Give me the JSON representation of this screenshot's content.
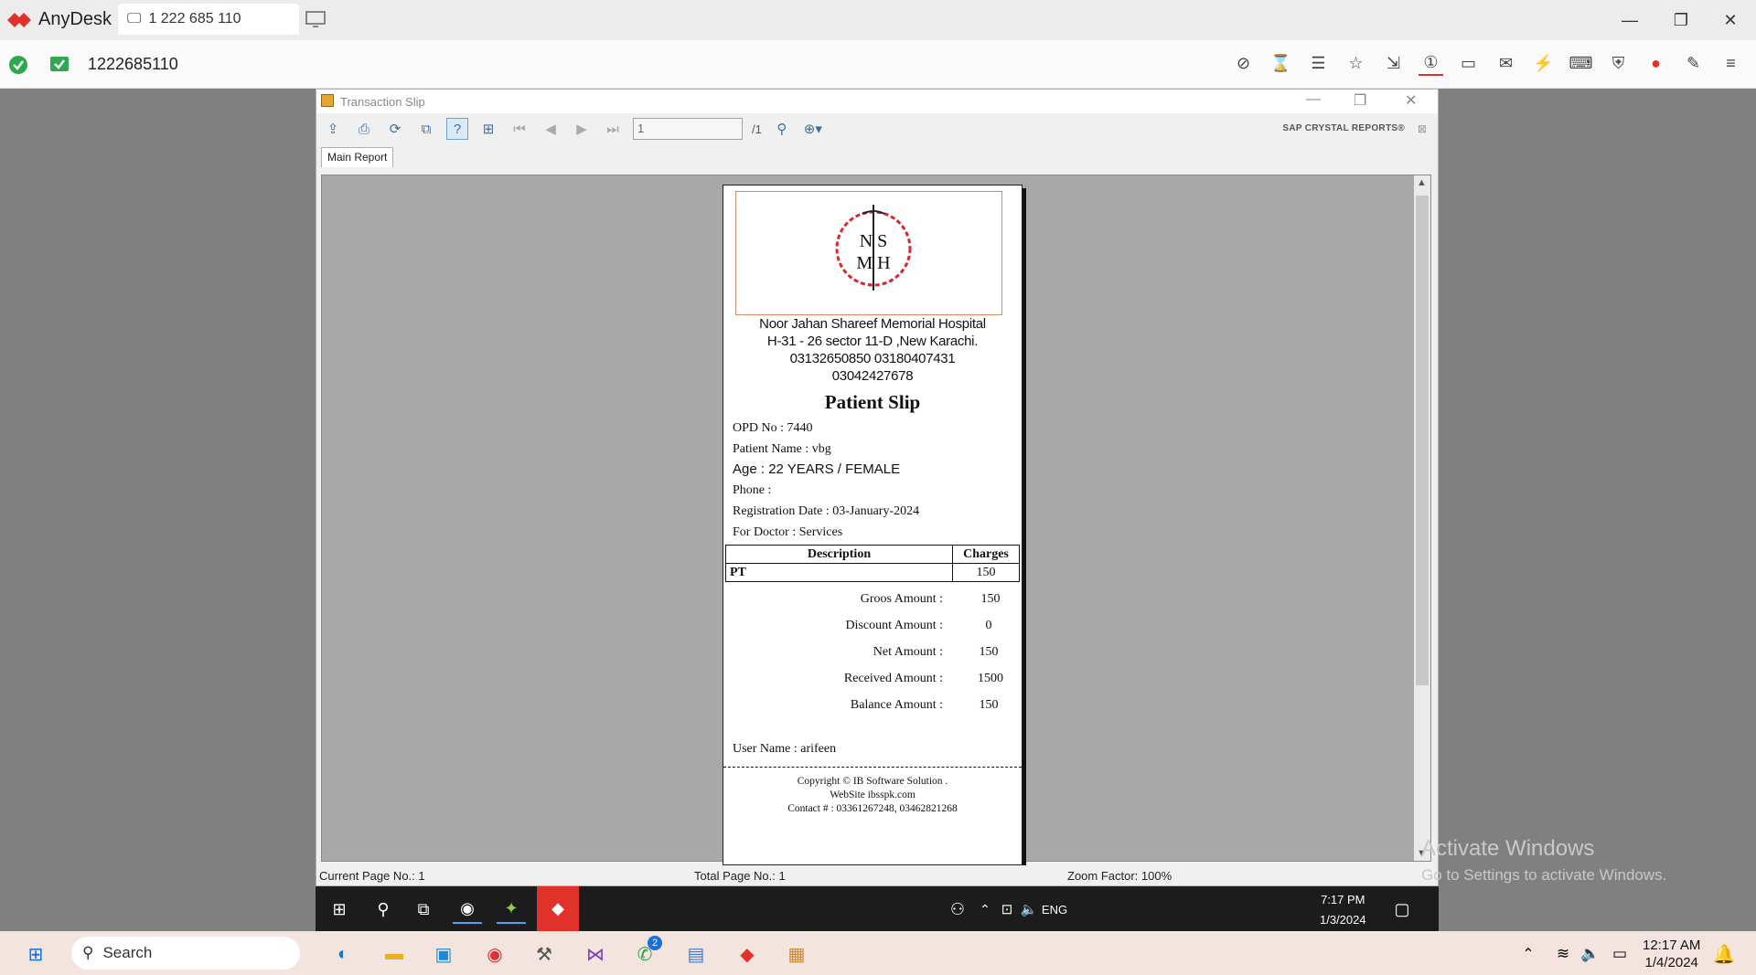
{
  "anydesk": {
    "app_name": "AnyDesk",
    "tab_label": "1 222 685 110",
    "remote_id": "1222685110"
  },
  "crystal": {
    "window_title": "Transaction Slip",
    "page_input": "1",
    "page_total": "/1",
    "brand": "SAP CRYSTAL REPORTS®",
    "tab": "Main Report",
    "status_current": "Current Page No.: 1",
    "status_total": "Total Page No.: 1",
    "status_zoom": "Zoom Factor: 100%"
  },
  "report": {
    "logo_text_top": "N S",
    "logo_text_bottom": "M H",
    "hospital_name": "Noor Jahan Shareef Memorial Hospital",
    "address": "H-31 - 26 sector 11-D ,New Karachi.",
    "phones1": "03132650850  03180407431",
    "phones2": "03042427678",
    "title": "Patient Slip",
    "opd": "OPD No : 7440",
    "patient_name": "Patient Name : vbg",
    "age": "Age : 22 YEARS / FEMALE",
    "phone": "Phone :",
    "reg_date": "Registration Date : 03-January-2024",
    "doctor": "For Doctor : Services",
    "table_headers": [
      "Description",
      "Charges"
    ],
    "table_rows": [
      [
        "PT",
        "150"
      ]
    ],
    "amounts": [
      {
        "label": "Groos Amount :",
        "value": "150"
      },
      {
        "label": "Discount Amount :",
        "value": "0"
      },
      {
        "label": "Net Amount :",
        "value": "150"
      },
      {
        "label": "Received Amount :",
        "value": "1500"
      },
      {
        "label": "Balance Amount :",
        "value": "150"
      }
    ],
    "user_name": "User Name : arifeen",
    "footer1": "Copyright © IB Software Solution .",
    "footer2": "WebSite ibsspk.com",
    "footer3": "Contact # : 03361267248, 03462821268"
  },
  "remote_taskbar": {
    "lang": "ENG",
    "time": "7:17 PM",
    "date": "1/3/2024"
  },
  "activation": {
    "line1": "Activate Windows",
    "line2": "Go to Settings to activate Windows."
  },
  "local_taskbar": {
    "search_placeholder": "Search",
    "time": "12:17 AM",
    "date": "1/4/2024",
    "whatsapp_badge": "2"
  }
}
